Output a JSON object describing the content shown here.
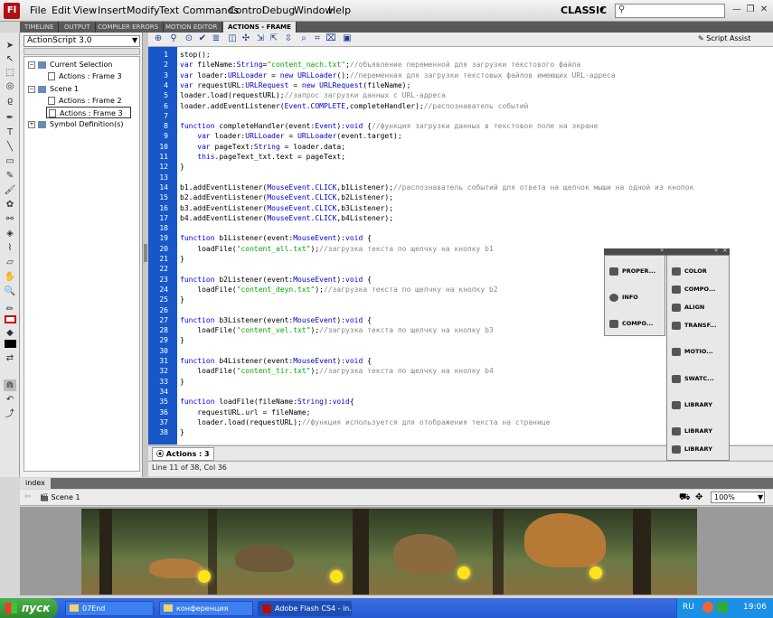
{
  "app": {
    "logo": "Fl",
    "workspace": "CLASSIC"
  },
  "menus": [
    "File",
    "Edit",
    "View",
    "Insert",
    "Modify",
    "Text",
    "Commands",
    "Control",
    "Debug",
    "Window",
    "Help"
  ],
  "search": {
    "placeholder": ""
  },
  "window_buttons": [
    "—",
    "❐",
    "✕"
  ],
  "tabs": [
    "TIMELINE",
    "OUTPUT",
    "COMPILER ERRORS",
    "MOTION EDITOR",
    "ACTIONS - FRAME"
  ],
  "actions_nav": {
    "version": "ActionScript 3.0",
    "tree": [
      {
        "label": "Current Selection",
        "level": 0,
        "kind": "folder"
      },
      {
        "label": "Actions : Frame 3",
        "level": 1,
        "kind": "action"
      },
      {
        "label": "Scene 1",
        "level": 0,
        "kind": "folder"
      },
      {
        "label": "Actions : Frame 2",
        "level": 1,
        "kind": "action"
      },
      {
        "label": "Actions : Frame 3",
        "level": 1,
        "kind": "action",
        "selected": true
      },
      {
        "label": "Symbol Definition(s)",
        "level": 0,
        "kind": "folder"
      }
    ]
  },
  "editor": {
    "script_assist": "Script Assist",
    "tab": "Actions : 3",
    "status": "Line 11 of 38, Col 36",
    "lines": [
      "stop();",
      "var fileName:String=\"content_nach.txt\";//объявление переменной для загрузки текстового файла",
      "var loader:URLLoader = new URLLoader();//переменная для загрузки текстовых файлов имеющих URL-адреса",
      "var requestURL:URLRequest = new URLRequest(fileName);",
      "loader.load(requestURL);//запрос загрузки данных с URL-адреса",
      "loader.addEventListener(Event.COMPLETE,completeHandler);//распознаватель событий",
      "",
      "function completeHandler(event:Event):void {//функция загрузки данных в текстовое поле на экране",
      "    var loader:URLLoader = URLLoader(event.target);",
      "    var pageText:String = loader.data;",
      "    this.pageText_txt.text = pageText;",
      "}",
      "",
      "b1.addEventListener(MouseEvent.CLICK,b1Listener);//распознаватель событий для ответа на щелчок мыши на одной из кнопок",
      "b2.addEventListener(MouseEvent.CLICK,b2Listener);",
      "b3.addEventListener(MouseEvent.CLICK,b3Listener);",
      "b4.addEventListener(MouseEvent.CLICK,b4Listener);",
      "",
      "function b1Listener(event:MouseEvent):void {",
      "    loadFile(\"content_all.txt\");//загрузка текста по щелчку на кнопку b1",
      "}",
      "",
      "function b2Listener(event:MouseEvent):void {",
      "    loadFile(\"content_deyn.txt\");//загрузка текста по щелчку на кнопку b2",
      "}",
      "",
      "function b3Listener(event:MouseEvent):void {",
      "    loadFile(\"content_vel.txt\");//загрузка текста по щелчку на кнопку b3",
      "}",
      "",
      "function b4Listener(event:MouseEvent):void {",
      "    loadFile(\"content_tir.txt\");//загрузка текста по щелчку на кнопку b4",
      "}",
      "",
      "function loadFile(fileName:String):void{",
      "    requestURL.url = fileName;",
      "    loader.load(requestURL);//функция используется для отображения текста на странице",
      "}"
    ]
  },
  "panels": {
    "left": [
      "PROPER...",
      "INFO",
      "COMPO..."
    ],
    "right": [
      "COLOR",
      "COMPO...",
      "ALIGN",
      "TRANSF...",
      "MOTIO...",
      "SWATC...",
      "LIBRARY",
      "LIBRARY",
      "LIBRARY"
    ]
  },
  "stage": {
    "tab": "index",
    "scene": "Scene 1",
    "zoom": "100%"
  },
  "taskbar": {
    "start": "пуск",
    "tasks": [
      "07End",
      "конференция",
      "Adobe Flash CS4 - in..."
    ],
    "lang": "RU",
    "clock": "19:06"
  }
}
